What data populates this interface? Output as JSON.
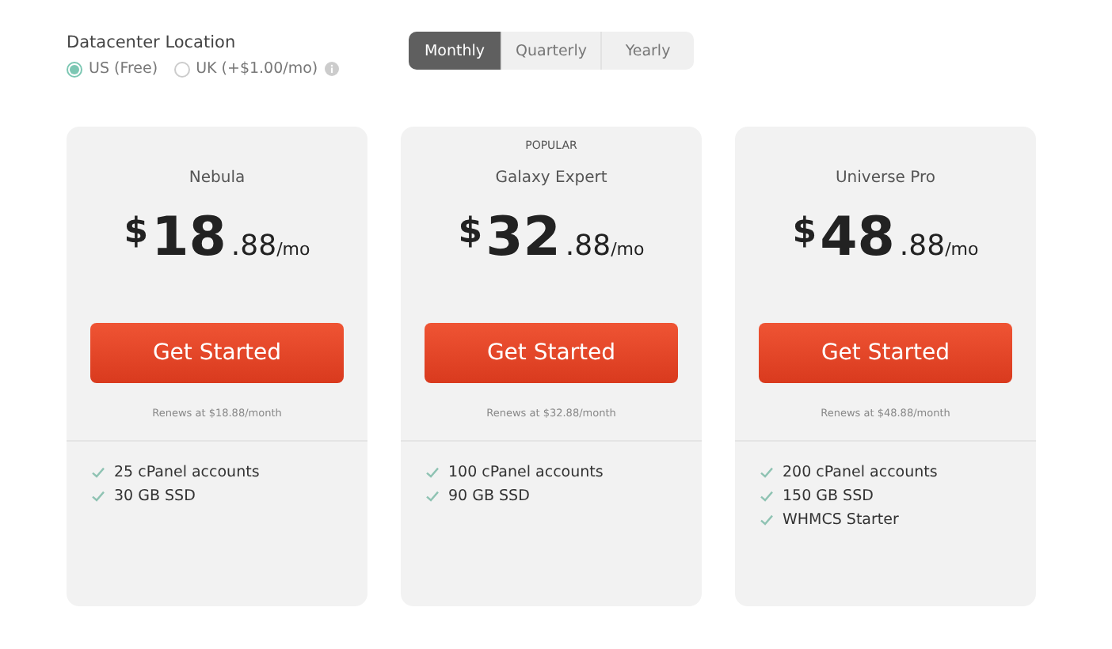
{
  "location": {
    "title": "Datacenter Location",
    "options": [
      {
        "label": "US (Free)",
        "selected": true,
        "info": false
      },
      {
        "label": "UK (+$1.00/mo)",
        "selected": false,
        "info": true
      }
    ]
  },
  "billing_tabs": [
    {
      "label": "Monthly",
      "selected": true
    },
    {
      "label": "Quarterly",
      "selected": false
    },
    {
      "label": "Yearly",
      "selected": false
    }
  ],
  "plans": [
    {
      "name": "Nebula",
      "currency": "$",
      "amount": "18",
      "cents": ".88",
      "period": "/mo",
      "button": "Get Started",
      "renews": "Renews at $18.88/month",
      "features": [
        "25 cPanel accounts",
        "30 GB SSD"
      ]
    },
    {
      "badge": "POPULAR",
      "name": "Galaxy Expert",
      "currency": "$",
      "amount": "32",
      "cents": ".88",
      "period": "/mo",
      "button": "Get Started",
      "renews": "Renews at $32.88/month",
      "features": [
        "100 cPanel accounts",
        "90 GB SSD"
      ]
    },
    {
      "name": "Universe Pro",
      "currency": "$",
      "amount": "48",
      "cents": ".88",
      "period": "/mo",
      "button": "Get Started",
      "renews": "Renews at $48.88/month",
      "features": [
        "200 cPanel accounts",
        "150 GB SSD",
        "WHMCS Starter"
      ]
    }
  ]
}
